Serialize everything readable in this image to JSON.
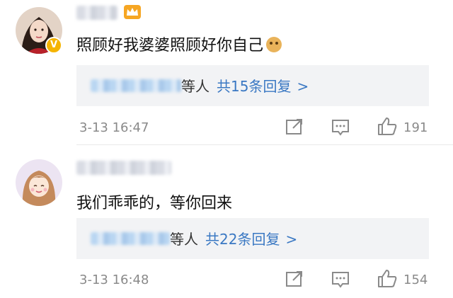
{
  "comments": [
    {
      "text": "照顾好我婆婆照顾好你自己",
      "replies_by": "等人",
      "replies_count": "共15条回复",
      "chevron": ">",
      "time": "3-13 16:47",
      "likes": "191",
      "has_verified_badge": true,
      "has_crown": true,
      "emoji": "doge"
    },
    {
      "text": "我们乖乖的，等你回来",
      "replies_by": "等人",
      "replies_count": "共22条回复",
      "chevron": ">",
      "time": "3-13 16:48",
      "likes": "154",
      "has_verified_badge": false,
      "has_crown": false,
      "emoji": ""
    }
  ],
  "icons": {
    "share": "share-icon",
    "comment": "comment-icon",
    "like": "thumbs-up-icon",
    "verified": "verified-badge-icon",
    "crown": "crown-icon"
  },
  "colors": {
    "link_blue": "#3a78c3",
    "muted_gray": "#8a8a8a",
    "reply_bg": "#f2f3f5",
    "badge_gold": "#f5b400"
  }
}
